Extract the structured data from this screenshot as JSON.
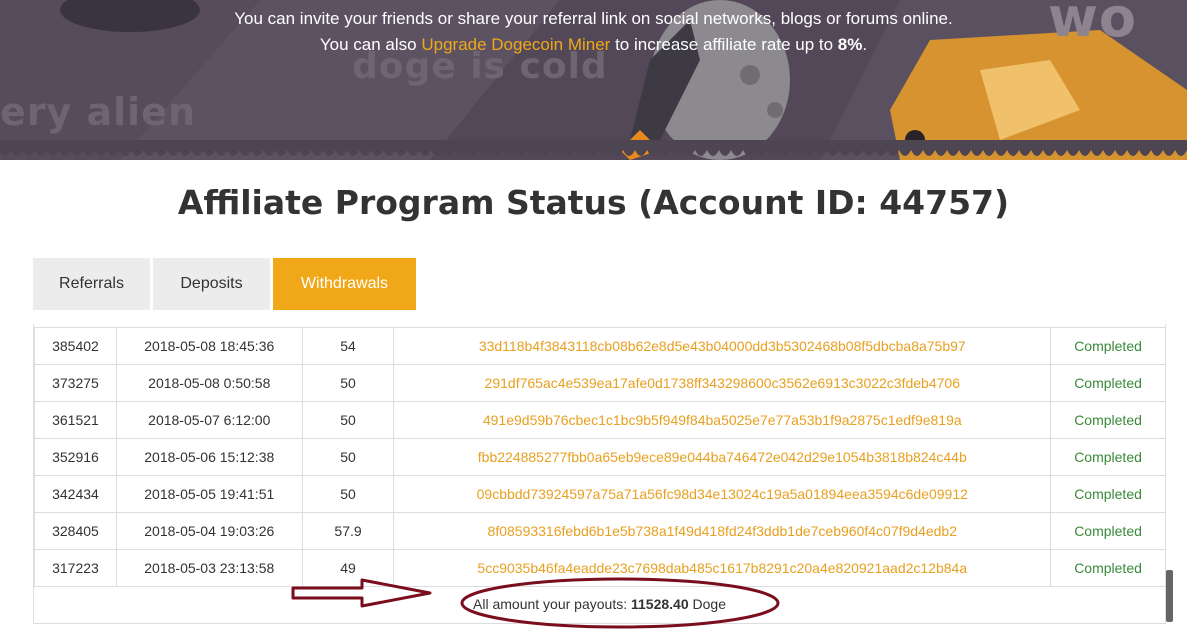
{
  "hero": {
    "line1": "You can invite your friends or share your referral link on social networks, blogs or forums online.",
    "line2_prefix": "You can also ",
    "line2_link": "Upgrade Dogecoin Miner",
    "line2_suffix": " to increase affiliate rate up to ",
    "line2_rate": "8%",
    "line2_end": ".",
    "bg_text_1": "doge is cold",
    "bg_text_2": "ery alien",
    "bg_text_3": "wo"
  },
  "page_title": "Affiliate Program Status (Account ID: 44757)",
  "tabs": [
    {
      "label": "Referrals",
      "active": false
    },
    {
      "label": "Deposits",
      "active": false
    },
    {
      "label": "Withdrawals",
      "active": true
    }
  ],
  "withdrawals": [
    {
      "id": "385402",
      "date": "2018-05-08 18:45:36",
      "amount": "54",
      "tx": "33d118b4f3843118cb08b62e8d5e43b04000dd3b5302468b08f5dbcba8a75b97",
      "status": "Completed"
    },
    {
      "id": "373275",
      "date": "2018-05-08 0:50:58",
      "amount": "50",
      "tx": "291df765ac4e539ea17afe0d1738ff343298600c3562e6913c3022c3fdeb4706",
      "status": "Completed"
    },
    {
      "id": "361521",
      "date": "2018-05-07 6:12:00",
      "amount": "50",
      "tx": "491e9d59b76cbec1c1bc9b5f949f84ba5025e7e77a53b1f9a2875c1edf9e819a",
      "status": "Completed"
    },
    {
      "id": "352916",
      "date": "2018-05-06 15:12:38",
      "amount": "50",
      "tx": "fbb224885277fbb0a65eb9ece89e044ba746472e042d29e1054b3818b824c44b",
      "status": "Completed"
    },
    {
      "id": "342434",
      "date": "2018-05-05 19:41:51",
      "amount": "50",
      "tx": "09cbbdd73924597a75a71a56fc98d34e13024c19a5a01894eea3594c6de09912",
      "status": "Completed"
    },
    {
      "id": "328405",
      "date": "2018-05-04 19:03:26",
      "amount": "57.9",
      "tx": "8f08593316febd6b1e5b738a1f49d418fd24f3ddb1de7ceb960f4c07f9d4edb2",
      "status": "Completed"
    },
    {
      "id": "317223",
      "date": "2018-05-03 23:13:58",
      "amount": "49",
      "tx": "5cc9035b46fa4eadde23c7698dab485c1617b8291c20a4e820921aad2c12b84a",
      "status": "Completed"
    }
  ],
  "footer": {
    "label": "All amount your payouts: ",
    "total": "11528.40",
    "unit": " Doge"
  },
  "colors": {
    "accent": "#f0a818",
    "status_completed": "#3a8a3a",
    "annotation": "#7a0e1c"
  }
}
